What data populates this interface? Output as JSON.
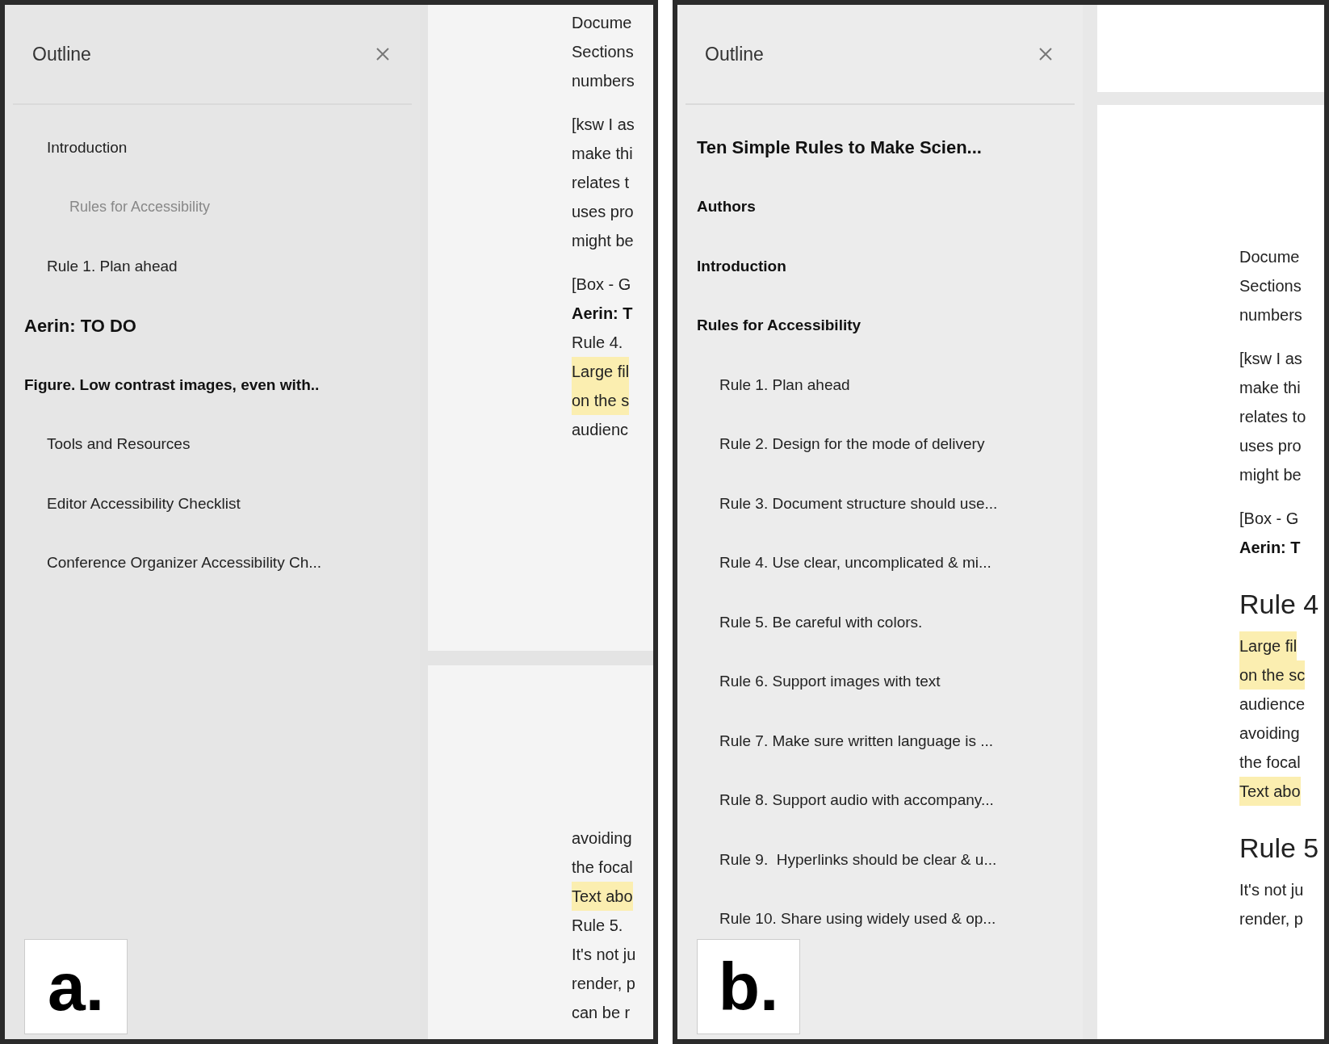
{
  "panels": [
    {
      "label": "a.",
      "outline": {
        "title": "Outline",
        "items": [
          {
            "text": "Introduction",
            "kind": "h2"
          },
          {
            "text": "Rules for Accessibility",
            "kind": "h3"
          },
          {
            "text": "Rule 1. Plan ahead",
            "kind": "h2"
          },
          {
            "text": "Aerin: TO DO",
            "kind": "title"
          },
          {
            "text": "Figure. Low contrast images, even with..",
            "kind": "h1"
          },
          {
            "text": "Tools and Resources",
            "kind": "h2"
          },
          {
            "text": "Editor Accessibility Checklist",
            "kind": "h2"
          },
          {
            "text": "Conference Organizer Accessibility Ch...",
            "kind": "h2"
          }
        ]
      },
      "document": {
        "pages": [
          {
            "paragraphs": [
              [
                {
                  "text": "Docume",
                  "kind": "text"
                },
                {
                  "text": "Sections",
                  "kind": "text"
                },
                {
                  "text": "numbers",
                  "kind": "text"
                }
              ],
              [
                {
                  "text": "[ksw I as",
                  "kind": "text"
                },
                {
                  "text": "make thi",
                  "kind": "text"
                },
                {
                  "text": "relates t",
                  "kind": "text"
                },
                {
                  "text": "uses pro",
                  "kind": "text"
                },
                {
                  "text": "might be",
                  "kind": "text"
                }
              ],
              [
                {
                  "text": "[Box - G",
                  "kind": "text"
                },
                {
                  "text": "Aerin: T",
                  "kind": "bold"
                },
                {
                  "text": "Rule 4.",
                  "kind": "text"
                },
                {
                  "text": "Large fil",
                  "kind": "highlight"
                },
                {
                  "text": "on the s",
                  "kind": "highlight"
                },
                {
                  "text": "audienc",
                  "kind": "text"
                }
              ]
            ]
          },
          {
            "paragraphs": [
              [
                {
                  "text": "avoiding",
                  "kind": "text"
                },
                {
                  "text": "the focal",
                  "kind": "text"
                },
                {
                  "text": "Text abo",
                  "kind": "highlight"
                },
                {
                  "text": "Rule 5.",
                  "kind": "text"
                },
                {
                  "text": "It's not ju",
                  "kind": "text"
                },
                {
                  "text": "render, p",
                  "kind": "text"
                },
                {
                  "text": "can be r",
                  "kind": "text"
                }
              ]
            ]
          }
        ]
      }
    },
    {
      "label": "b.",
      "outline": {
        "title": "Outline",
        "items": [
          {
            "text": "Ten Simple Rules to Make Scien...",
            "kind": "title"
          },
          {
            "text": "Authors",
            "kind": "h1"
          },
          {
            "text": "Introduction",
            "kind": "h1"
          },
          {
            "text": "Rules for Accessibility",
            "kind": "h1"
          },
          {
            "text": "Rule 1. Plan ahead",
            "kind": "h2"
          },
          {
            "text": "Rule 2. Design for the mode of delivery",
            "kind": "h2"
          },
          {
            "text": "Rule 3. Document structure should use...",
            "kind": "h2"
          },
          {
            "text": "Rule 4. Use clear, uncomplicated & mi...",
            "kind": "h2"
          },
          {
            "text": "Rule 5. Be careful with colors.",
            "kind": "h2"
          },
          {
            "text": "Rule 6. Support images with text",
            "kind": "h2"
          },
          {
            "text": "Rule 7. Make sure written language is ...",
            "kind": "h2"
          },
          {
            "text": "Rule 8. Support audio with accompany...",
            "kind": "h2"
          },
          {
            "text": "Rule 9.  Hyperlinks should be clear & u...",
            "kind": "h2"
          },
          {
            "text": "Rule 10. Share using widely used & op...",
            "kind": "h2"
          }
        ]
      },
      "document": {
        "page_above": true,
        "pages": [
          {
            "paragraphs": [
              [
                {
                  "text": "Docume",
                  "kind": "text"
                },
                {
                  "text": "Sections",
                  "kind": "text"
                },
                {
                  "text": "numbers",
                  "kind": "text"
                }
              ],
              [
                {
                  "text": "[ksw I as",
                  "kind": "text"
                },
                {
                  "text": "make thi",
                  "kind": "text"
                },
                {
                  "text": "relates to",
                  "kind": "text"
                },
                {
                  "text": "uses pro",
                  "kind": "text"
                },
                {
                  "text": "might be",
                  "kind": "text"
                }
              ],
              [
                {
                  "text": "[Box - G",
                  "kind": "text"
                },
                {
                  "text": "Aerin: T",
                  "kind": "bold"
                }
              ],
              [
                {
                  "text": "Rule 4",
                  "kind": "heading"
                },
                {
                  "text": "Large fil",
                  "kind": "highlight"
                },
                {
                  "text": "on the sc",
                  "kind": "highlight"
                },
                {
                  "text": "audience",
                  "kind": "text"
                },
                {
                  "text": "avoiding",
                  "kind": "text"
                },
                {
                  "text": "the focal",
                  "kind": "text"
                },
                {
                  "text": "Text abo",
                  "kind": "highlight"
                }
              ],
              [
                {
                  "text": "Rule 5",
                  "kind": "heading"
                },
                {
                  "text": "It's not ju",
                  "kind": "text"
                },
                {
                  "text": "render, p",
                  "kind": "text"
                }
              ]
            ]
          }
        ]
      }
    }
  ]
}
